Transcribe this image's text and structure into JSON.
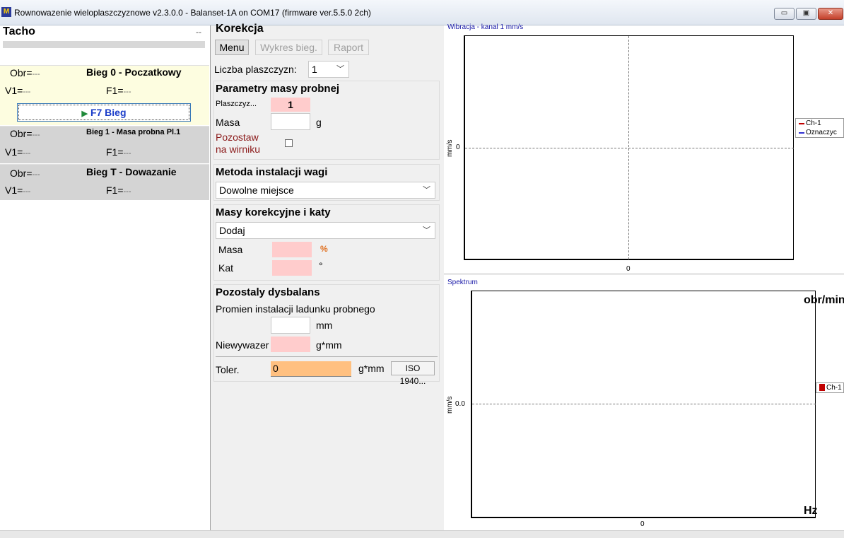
{
  "window": {
    "title": "Rownowazenie wieloplaszczyznowe v2.3.0.0 - Balanset-1A on COM17 (firmware ver.5.5.0 2ch)",
    "app_icon": "balanset-logo-icon",
    "minimize_glyph": "▭",
    "maximize_glyph": "▣",
    "close_glyph": "✕"
  },
  "tacho": {
    "title": "Tacho",
    "value": "--"
  },
  "runs": [
    {
      "title": "Bieg 0 - Poczatkowy",
      "obr_label": "Obr=",
      "obr_value": "---",
      "v1_label": "V1=",
      "v1_value": "---",
      "f1_label": "F1=",
      "f1_value": "---",
      "button_label": "F7 Bieg",
      "button_icon": "play-icon"
    },
    {
      "title": "Bieg 1 - Masa probna Pl.1",
      "obr_label": "Obr=",
      "obr_value": "---",
      "v1_label": "V1=",
      "v1_value": "---",
      "f1_label": "F1=",
      "f1_value": "---"
    },
    {
      "title": "Bieg T - Dowazanie",
      "obr_label": "Obr=",
      "obr_value": "---",
      "v1_label": "V1=",
      "v1_value": "---",
      "f1_label": "F1=",
      "f1_value": "---"
    }
  ],
  "korekcja": {
    "title": "Korekcja",
    "menu_button": "Menu",
    "wykres_button": "Wykres bieg.",
    "raport_button": "Raport",
    "liczba_label": "Liczba plaszczyzn:",
    "liczba_value": "1"
  },
  "masa_probna": {
    "title": "Parametry masy probnej",
    "plaszczyzna_label": "Plaszczyz...",
    "plaszczyzna_value": "1",
    "masa_label": "Masa",
    "masa_value": "",
    "masa_unit": "g",
    "pozostaw_label_1": "Pozostaw",
    "pozostaw_label_2": "na wirniku"
  },
  "metoda": {
    "title": "Metoda instalacji wagi",
    "selected": "Dowolne miejsce"
  },
  "korekcyjne": {
    "title": "Masy korekcyjne i katy",
    "selected": "Dodaj",
    "masa_label": "Masa",
    "masa_unit": "%",
    "kat_label": "Kat",
    "kat_unit": "°"
  },
  "dysbalans": {
    "title": "Pozostaly dysbalans",
    "promien_label": "Promien instalacji ladunku probnego",
    "promien_unit": "mm",
    "niewywazenie_label": "Niewywazer",
    "niewywazenie_unit": "g*mm",
    "toler_label": "Toler.",
    "toler_value": "0",
    "toler_unit": "g*mm",
    "iso_button": "ISO 1940..."
  },
  "colors": {
    "accent_blue": "#1a3cc8",
    "pink_field": "#ffcccc",
    "orange_field": "#ffc080",
    "run0_bg": "#fdfde0",
    "run_bg": "#d4d4d4",
    "ch1_color": "#c00000",
    "marker_color": "#3030d0"
  },
  "charts": {
    "vibration": {
      "title": "Wibracja - kanal 1 mm/s",
      "ylabel": "mm/s",
      "y_tick": "0",
      "x_tick": "0",
      "legend": [
        "Ch-1",
        "Oznaczyc"
      ]
    },
    "spectrum": {
      "title": "Spektrum",
      "ylabel": "mm/s",
      "y_tick": "0.0",
      "x_tick": "0",
      "unit_top": "obr/min",
      "unit_bottom": "Hz",
      "legend": [
        "Ch-1"
      ]
    }
  }
}
